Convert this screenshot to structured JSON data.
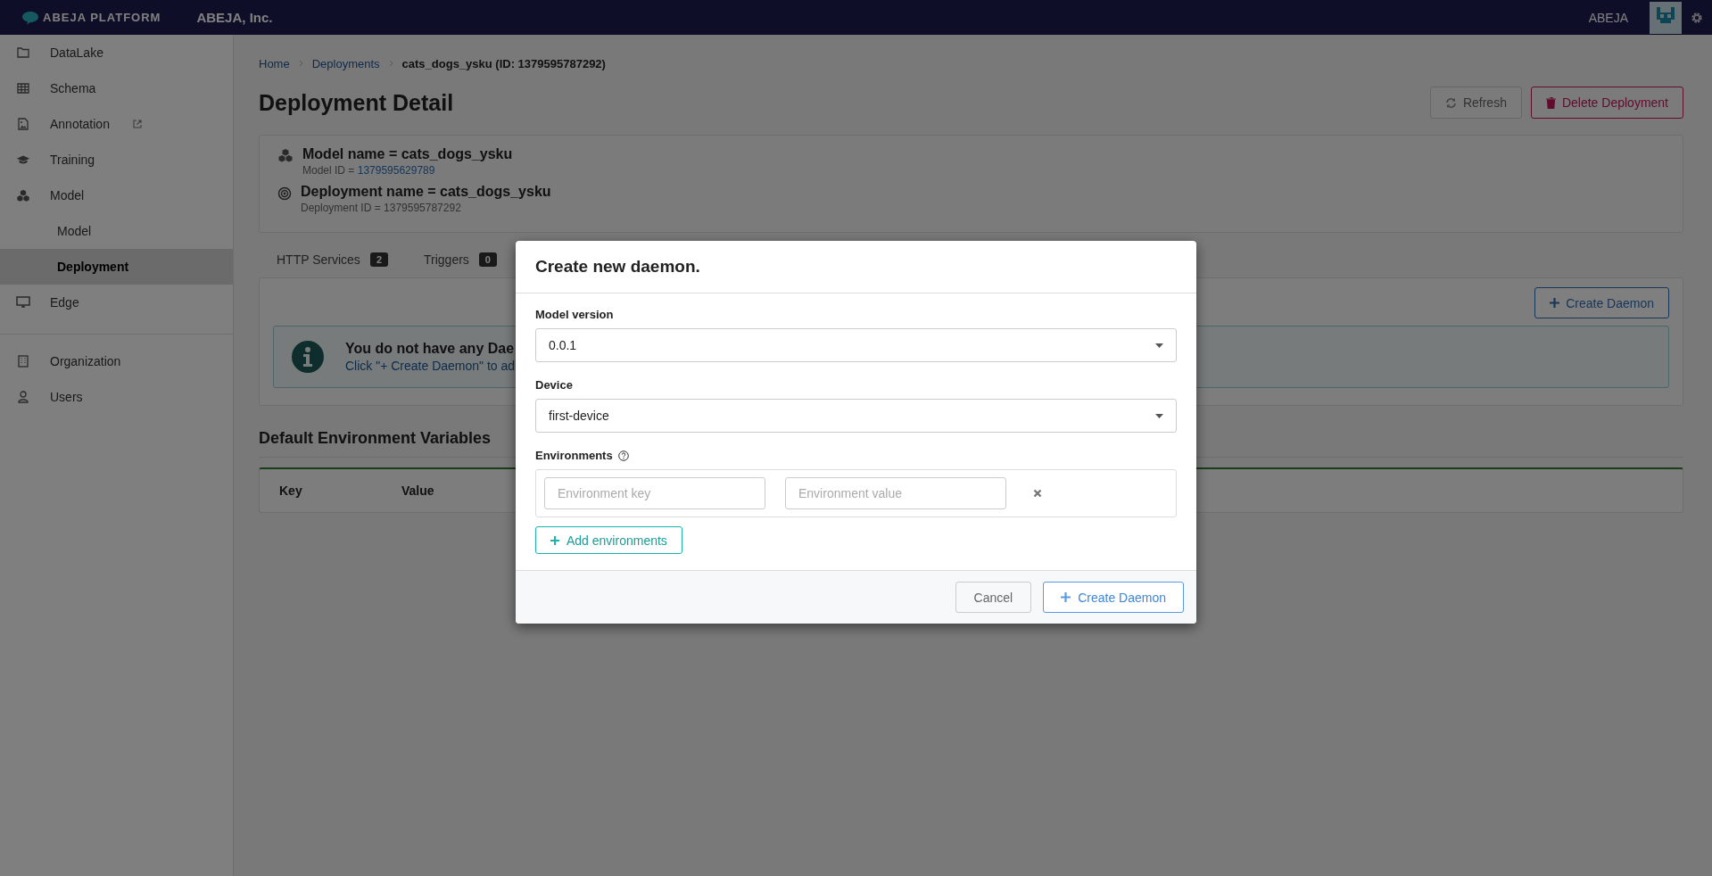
{
  "topbar": {
    "logo": "ABEJA PLATFORM",
    "organization": "ABEJA, Inc.",
    "user": "ABEJA"
  },
  "sidebar": {
    "items": [
      {
        "label": "DataLake",
        "selected": false,
        "external": false
      },
      {
        "label": "Schema",
        "selected": false,
        "external": false
      },
      {
        "label": "Annotation",
        "selected": false,
        "external": true
      },
      {
        "label": "Training",
        "selected": false,
        "external": false
      },
      {
        "label": "Model",
        "selected": false,
        "external": false,
        "children": [
          {
            "label": "Model",
            "selected": false
          },
          {
            "label": "Deployment",
            "selected": true
          }
        ]
      },
      {
        "label": "Edge",
        "selected": false,
        "external": false
      }
    ],
    "bottom_items": [
      {
        "label": "Organization",
        "selected": false
      },
      {
        "label": "Users",
        "selected": false
      }
    ]
  },
  "breadcrumb": [
    {
      "label": "Home",
      "kind": "link"
    },
    {
      "label": "Deployments",
      "kind": "link"
    },
    {
      "label": "cats_dogs_ysku (ID: 1379595787292)",
      "kind": "current"
    }
  ],
  "title": "Deployment Detail",
  "actions": [
    {
      "label": "Refresh",
      "kind": "default"
    },
    {
      "label": "Delete Deployment",
      "kind": "danger"
    }
  ],
  "info": {
    "model_name": "Model name = cats_dogs_ysku",
    "model_id_label": "Model ID = ",
    "model_id": "1379595629789",
    "deployment_name": "Deployment name = cats_dogs_ysku",
    "deployment_id": "Deployment ID = 1379595787292"
  },
  "tabs": [
    {
      "label": "HTTP Services",
      "count": "2",
      "selected": false
    },
    {
      "label": "Triggers",
      "count": "0",
      "selected": false
    }
  ],
  "daemons": {
    "create_button": "Create Daemon",
    "empty_title": "You do not have any Dae",
    "empty_hint": "Click \"+ Create Daemon\" to ad"
  },
  "env_section": {
    "title": "Default Environment Variables",
    "columns": [
      "Key",
      "Value"
    ]
  },
  "modal": {
    "title": "Create new daemon.",
    "fields": [
      {
        "label": "Model version",
        "value": "0.0.1"
      },
      {
        "label": "Device",
        "value": "first-device"
      }
    ],
    "environments": {
      "label": "Environments",
      "rows": [
        {
          "key_placeholder": "Environment key",
          "value_placeholder": "Environment value"
        }
      ],
      "add_button": "Add environments"
    },
    "buttons": [
      {
        "label": "Cancel",
        "kind": "cancel"
      },
      {
        "label": "Create Daemon",
        "kind": "primary"
      }
    ]
  }
}
